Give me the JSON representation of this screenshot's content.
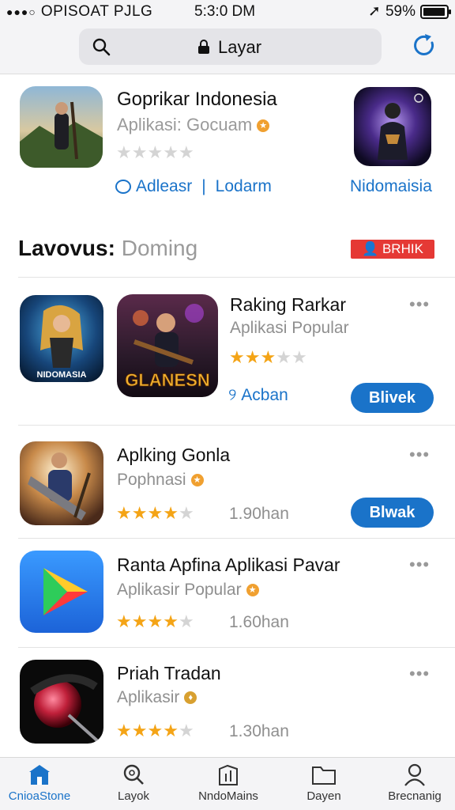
{
  "status_bar": {
    "carrier": "OPISOAT PJLG",
    "time": "5:3:0 DM",
    "battery": "59%"
  },
  "address_bar": {
    "address": "Layar"
  },
  "featured": {
    "title": "Goprikar Indonesia",
    "subtitle": "Aplikasi: Gocuam",
    "rating": 0,
    "link_left": "Adleasr",
    "link_right": "Lodarm",
    "side_link": "Nidomaisia"
  },
  "section": {
    "title_bold": "Lavovus:",
    "title_muted": "Doming",
    "badge": "BRHIK"
  },
  "row1": {
    "left_icon_label": "NIDOMASIA",
    "icon_label": "GLANESN",
    "title": "Raking Rarkar",
    "subtitle": "Aplikasi Popular",
    "rating": 3,
    "link": "Acban",
    "button": "Blivek"
  },
  "row2": {
    "title": "Aplking Gonla",
    "subtitle": "Pophnasi",
    "rating": 4,
    "rating_text": "1.90han",
    "button": "Blwak"
  },
  "row3": {
    "title": "Ranta Apfina Aplikasi Pavar",
    "subtitle": "Aplikasir Popular",
    "rating": 4,
    "rating_text": "1.60han"
  },
  "row4": {
    "title": "Priah Tradan",
    "subtitle": "Aplikasir",
    "rating": 4,
    "rating_text": "1.30han"
  },
  "bottom_nav": [
    {
      "label": "CnioaStone",
      "icon": "store-icon"
    },
    {
      "label": "Layok",
      "icon": "search-icon"
    },
    {
      "label": "NndoMains",
      "icon": "chart-icon"
    },
    {
      "label": "Dayen",
      "icon": "folder-icon"
    },
    {
      "label": "Brecnanig",
      "icon": "person-icon"
    }
  ],
  "colors": {
    "accent": "#1a73c9",
    "star": "#f4a416",
    "badge": "#e53935"
  }
}
